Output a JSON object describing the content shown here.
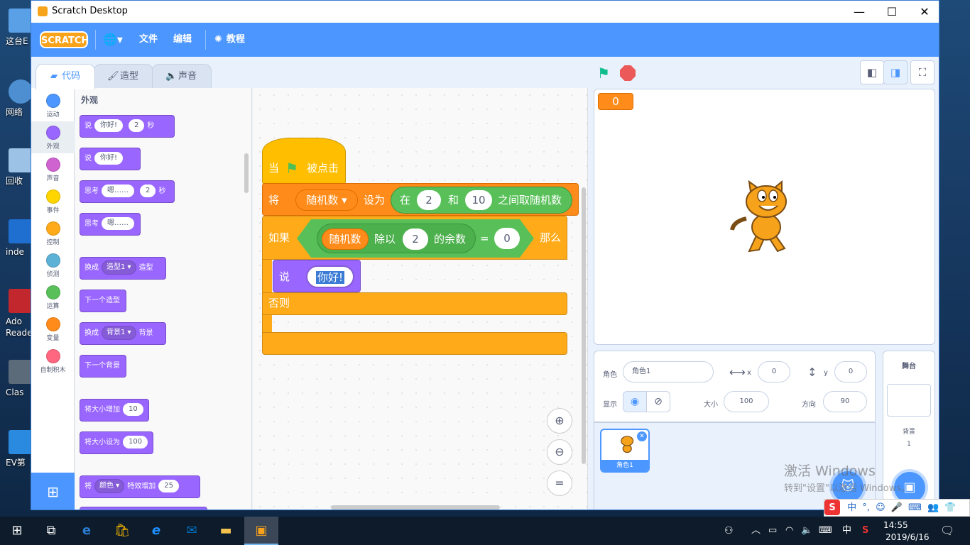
{
  "desktop": {
    "icons": [
      {
        "label": "这台E",
        "color": "#5aa0e6"
      },
      {
        "label": "网络",
        "color": "#4e8fd1"
      },
      {
        "label": "回收",
        "color": "#9cc3e5"
      },
      {
        "label": "inde",
        "color": "#1e6fd0"
      },
      {
        "label": "Ado",
        "label2": "Reade",
        "color": "#c1272d"
      },
      {
        "label": "Clas",
        "color": "#5c6b7a"
      },
      {
        "label": "EV第",
        "color": "#2a8ae0"
      }
    ]
  },
  "window": {
    "title": "Scratch Desktop",
    "minimize_icon": "—",
    "maximize_icon": "☐",
    "close_icon": "✕"
  },
  "menubar": {
    "logo": "SCRATCH",
    "language_icon": "🌐▾",
    "file_label": "文件",
    "edit_label": "编辑",
    "tutorials_label": "教程"
  },
  "tabs": {
    "code_label": "代码",
    "costumes_label": "造型",
    "sounds_label": "声音"
  },
  "categories": [
    {
      "label": "运动",
      "color": "#4c97ff"
    },
    {
      "label": "外观",
      "color": "#9966ff"
    },
    {
      "label": "声音",
      "color": "#cf63cf"
    },
    {
      "label": "事件",
      "color": "#ffd500"
    },
    {
      "label": "控制",
      "color": "#ffab19"
    },
    {
      "label": "侦测",
      "color": "#5cb1d6"
    },
    {
      "label": "运算",
      "color": "#59c059"
    },
    {
      "label": "变量",
      "color": "#ff8c1a"
    },
    {
      "label": "自制积木",
      "color": "#ff6680"
    }
  ],
  "palette": {
    "title": "外观",
    "blocks": {
      "say_secs": {
        "text": "说",
        "value": "你好!",
        "secs": "2",
        "unit": "秒"
      },
      "say": {
        "text": "说",
        "value": "你好!"
      },
      "think_secs": {
        "text": "思考",
        "value": "嗯……",
        "secs": "2",
        "unit": "秒"
      },
      "think": {
        "text": "思考",
        "value": "嗯……"
      },
      "switch_costume": {
        "text": "换成",
        "dropdown": "造型1 ▾",
        "suffix": "造型"
      },
      "next_costume": {
        "text": "下一个造型"
      },
      "switch_backdrop": {
        "text": "换成",
        "dropdown": "背景1 ▾",
        "suffix": "背景"
      },
      "next_backdrop": {
        "text": "下一个背景"
      },
      "change_size": {
        "text": "将大小增加",
        "value": "10"
      },
      "set_size": {
        "text": "将大小设为",
        "value": "100"
      },
      "change_effect": {
        "text": "将",
        "dropdown": "颜色 ▾",
        "suffix": "特效增加",
        "value": "25"
      }
    }
  },
  "script": {
    "hat_when": "当",
    "hat_clicked": "被点击",
    "set_label": "将",
    "set_var": "随机数 ▾",
    "set_to": "设为",
    "random_in": "在",
    "random_from": "2",
    "random_and": "和",
    "random_to": "10",
    "random_suffix": "之间取随机数",
    "if_label": "如果",
    "mod_var": "随机数",
    "mod_label": "除以",
    "mod_value": "2",
    "mod_suffix": "的余数",
    "eq_sign": "=",
    "eq_value": "0",
    "then_label": "那么",
    "say_label": "说",
    "say_value": "你好!",
    "else_label": "否则"
  },
  "zoom": {
    "in_icon": "⊕",
    "out_icon": "⊖",
    "reset_icon": "="
  },
  "stage": {
    "monitor_value": "0",
    "flag_icon": "⚑",
    "small_stage_icon": "◧",
    "large_stage_icon": "◨",
    "fullscreen_icon": "⛶"
  },
  "sprite_info": {
    "sprite_label": "角色",
    "sprite_name": "角色1",
    "x_label": "x",
    "x_value": "0",
    "y_label": "y",
    "y_value": "0",
    "show_label": "显示",
    "size_label": "大小",
    "size_value": "100",
    "direction_label": "方向",
    "direction_value": "90"
  },
  "sprites": [
    {
      "name": "角色1"
    }
  ],
  "stage_panel": {
    "title": "舞台",
    "backdrop_label": "背景",
    "backdrop_count": "1"
  },
  "watermark": {
    "line1": "激活 Windows",
    "line2": "转到\"设置\"以激活 Windows。"
  },
  "ime": {
    "items": [
      "S",
      "中",
      "°,",
      "☺",
      "🎤",
      "⌨",
      "👥",
      "👕",
      "⊞"
    ]
  },
  "taskbar": {
    "tray_input": "中",
    "time": "14:55",
    "date": "2019/6/16"
  }
}
